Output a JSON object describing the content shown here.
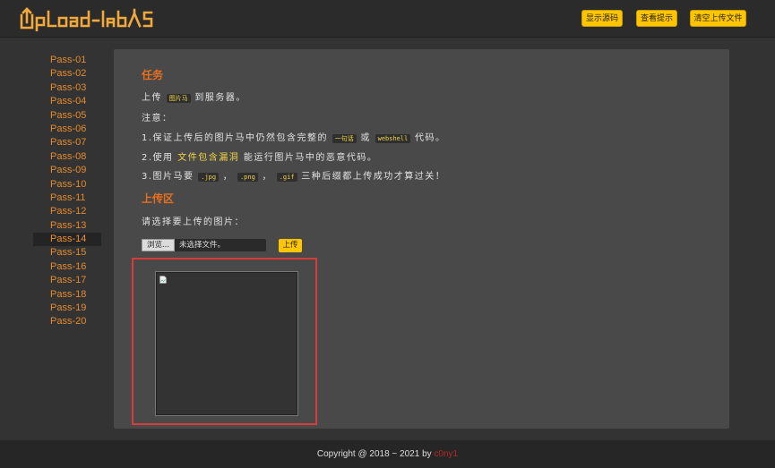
{
  "header": {
    "logo_text": "UpLoad-labs",
    "buttons": [
      "显示源码",
      "查看提示",
      "清空上传文件"
    ]
  },
  "sidebar": {
    "items": [
      "Pass-01",
      "Pass-02",
      "Pass-03",
      "Pass-04",
      "Pass-05",
      "Pass-06",
      "Pass-07",
      "Pass-08",
      "Pass-09",
      "Pass-10",
      "Pass-11",
      "Pass-12",
      "Pass-13",
      "Pass-14",
      "Pass-15",
      "Pass-16",
      "Pass-17",
      "Pass-18",
      "Pass-19",
      "Pass-20"
    ],
    "active": "Pass-14"
  },
  "task": {
    "heading": "任务",
    "line1_prefix": "上传",
    "line1_code": "图片马",
    "line1_suffix": "到服务器。",
    "note_label": "注意：",
    "rule1_a": "1.保证上传后的图片马中仍然包含完整的",
    "rule1_code1": "一句话",
    "rule1_b": "或",
    "rule1_code2": "webshell",
    "rule1_c": "代码。",
    "rule2_a": "2.使用",
    "rule2_link": "文件包含漏洞",
    "rule2_b": "能运行图片马中的恶意代码。",
    "rule3_a": "3.图片马要",
    "rule3_code1": ".jpg",
    "rule3_sep1": "，",
    "rule3_code2": ".png",
    "rule3_sep2": "，",
    "rule3_code3": ".gif",
    "rule3_b": "三种后缀都上传成功才算过关！"
  },
  "upload": {
    "heading": "上传区",
    "prompt": "请选择要上传的图片：",
    "browse_label": "浏览...",
    "no_file_label": "未选择文件。",
    "submit_label": "上传"
  },
  "footer": {
    "copyright": "Copyright @ 2018 ~ 2021 by ",
    "author": "c0ny1"
  },
  "colors": {
    "accent": "#ffc600",
    "heading": "#e86f1d",
    "sidebar_link": "#e58a2c",
    "preview_border": "#d93b3b"
  }
}
